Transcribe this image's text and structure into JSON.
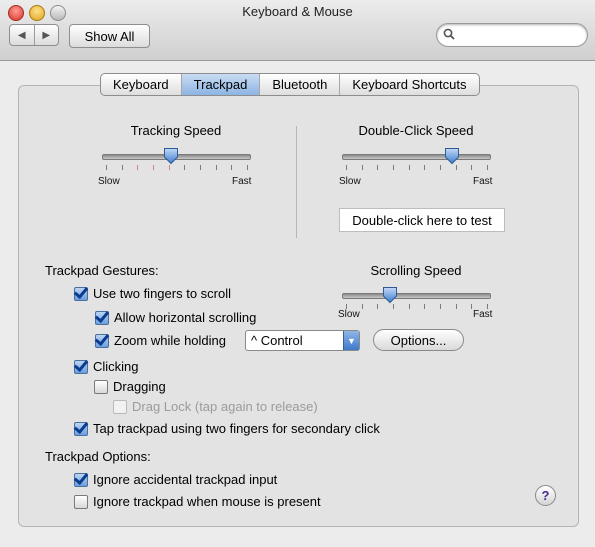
{
  "window": {
    "title": "Keyboard & Mouse"
  },
  "toolbar": {
    "show_all_label": "Show All",
    "back_icon": "◀",
    "forward_icon": "▶",
    "search_value": "",
    "search_placeholder": ""
  },
  "tabs": [
    {
      "label": "Keyboard",
      "active": false
    },
    {
      "label": "Trackpad",
      "active": true
    },
    {
      "label": "Bluetooth",
      "active": false
    },
    {
      "label": "Keyboard Shortcuts",
      "active": false
    }
  ],
  "tracking_speed": {
    "label": "Tracking Speed",
    "slow": "Slow",
    "fast": "Fast",
    "value": 0.46
  },
  "double_click_speed": {
    "label": "Double-Click Speed",
    "slow": "Slow",
    "fast": "Fast",
    "value": 0.77,
    "test_field": "Double-click here to test"
  },
  "scrolling_speed": {
    "label": "Scrolling Speed",
    "slow": "Slow",
    "fast": "Fast",
    "value": 0.3
  },
  "gestures": {
    "section_label": "Trackpad Gestures:",
    "two_finger_scroll": {
      "label": "Use two fingers to scroll",
      "checked": true
    },
    "horizontal_scroll": {
      "label": "Allow horizontal scrolling",
      "checked": true
    },
    "zoom": {
      "label": "Zoom while holding",
      "checked": true,
      "modifier": "^ Control",
      "options_label": "Options..."
    },
    "clicking": {
      "label": "Clicking",
      "checked": true
    },
    "dragging": {
      "label": "Dragging",
      "checked": false
    },
    "drag_lock": {
      "label": "Drag Lock (tap again to release)",
      "checked": false,
      "disabled": true
    },
    "secondary_click": {
      "label": "Tap trackpad using two fingers for secondary click",
      "checked": true
    }
  },
  "options": {
    "section_label": "Trackpad Options:",
    "ignore_accidental": {
      "label": "Ignore accidental trackpad input",
      "checked": true
    },
    "ignore_when_mouse": {
      "label": "Ignore trackpad when mouse is present",
      "checked": false
    }
  },
  "help": {
    "label": "?"
  }
}
